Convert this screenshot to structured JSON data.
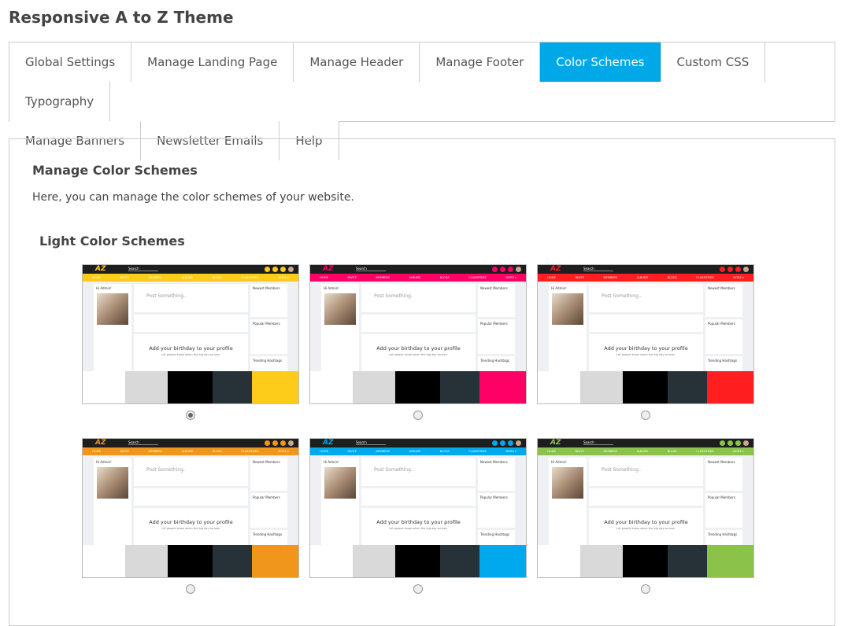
{
  "page_title": "Responsive A to Z Theme",
  "tabs": [
    {
      "label": "Global Settings"
    },
    {
      "label": "Manage Landing Page"
    },
    {
      "label": "Manage Header"
    },
    {
      "label": "Manage Footer"
    },
    {
      "label": "Color Schemes",
      "active": true
    },
    {
      "label": "Custom CSS"
    },
    {
      "label": "Typography"
    },
    {
      "label": "Manage Banners"
    },
    {
      "label": "Newsletter Emails"
    },
    {
      "label": "Help"
    }
  ],
  "panel": {
    "heading": "Manage Color Schemes",
    "description": "Here, you can manage the color schemes of your website.",
    "section_title": "Light Color Schemes"
  },
  "preview": {
    "logo": "AZ",
    "search": "Search",
    "nav": [
      "HOME",
      "INVITE",
      "MEMBERS",
      "ALBUMS",
      "BLOGS",
      "CLASSIFIEDS",
      "MORE ▾"
    ],
    "greeting": "Hi Admin!",
    "post_placeholder": "Post Something..",
    "birthday_title": "Add your birthday to your profile",
    "birthday_sub": "Let people know when the big day arrives.",
    "newest_members": "Newest Members",
    "popular_members": "Popular Members",
    "trending": "Trending Hashtags"
  },
  "swatch_base": [
    "#ffffff",
    "#d9d9d9",
    "#000000",
    "#263238"
  ],
  "schemes": [
    {
      "accent": "#fdcb19",
      "selected": true
    },
    {
      "accent": "#ff0066",
      "selected": false
    },
    {
      "accent": "#ff1f1f",
      "selected": false
    },
    {
      "accent": "#f0961a",
      "selected": false
    },
    {
      "accent": "#00a8ee",
      "selected": false
    },
    {
      "accent": "#8bc34a",
      "selected": false
    }
  ]
}
